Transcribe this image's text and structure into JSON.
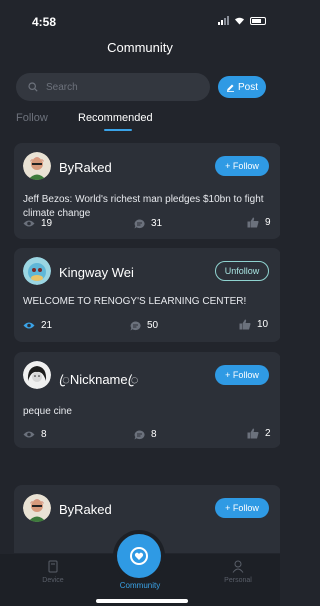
{
  "status_bar": {
    "time": "4:58",
    "icons": [
      "signal-icon",
      "wifi-icon",
      "battery-icon"
    ]
  },
  "header": {
    "title": "Community"
  },
  "search": {
    "placeholder": "Search",
    "post_label": "Post"
  },
  "tabs": [
    {
      "label": "Follow",
      "active": false
    },
    {
      "label": "Recommended",
      "active": true
    }
  ],
  "posts": [
    {
      "user": "ByRaked",
      "action": "+ Follow",
      "text": "Jeff Bezos: World's richest man pledges $10bn to fight climate change",
      "views": "19",
      "comments": "31",
      "likes": "9"
    },
    {
      "user": "Kingway Wei",
      "action": "Unfollow",
      "text": "WELCOME TO RENOGY'S LEARNING CENTER!",
      "views": "21",
      "comments": "50",
      "likes": "10"
    },
    {
      "user": "ꦿNicknameꦿ",
      "action": "+ Follow",
      "text": "peque cine",
      "views": "8",
      "comments": "8",
      "likes": "2"
    },
    {
      "user": "ByRaked",
      "action": "+ Follow",
      "text": "",
      "views": "",
      "comments": "",
      "likes": ""
    }
  ],
  "bottom_nav": [
    {
      "label": "Device",
      "icon": "device-icon",
      "active": false
    },
    {
      "label": "Community",
      "icon": "community-icon",
      "active": true
    },
    {
      "label": "Personal",
      "icon": "person-icon",
      "active": false
    }
  ],
  "colors": {
    "background": "#22252c",
    "card": "#2c3038",
    "accent": "#2f9ae4",
    "unfollow_border": "#8fd3d0"
  }
}
